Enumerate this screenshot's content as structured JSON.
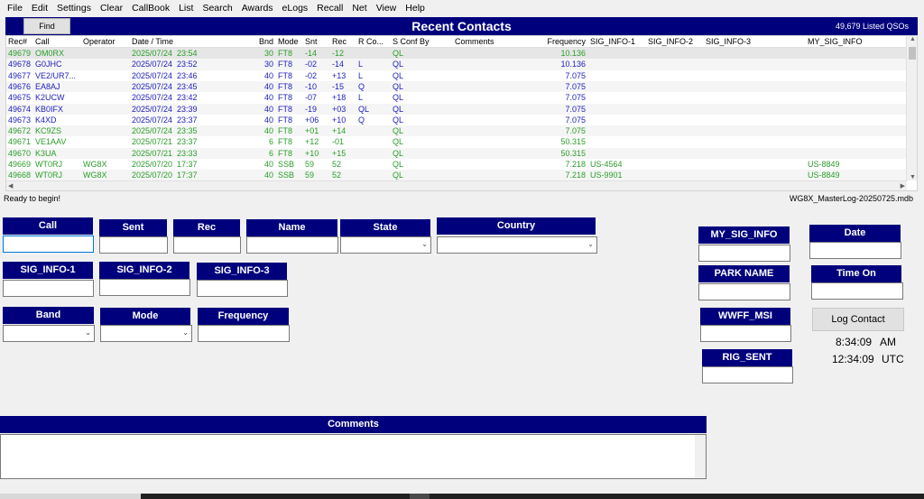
{
  "menu": [
    "File",
    "Edit",
    "Settings",
    "Clear",
    "CallBook",
    "List",
    "Search",
    "Awards",
    "eLogs",
    "Recall",
    "Net",
    "View",
    "Help"
  ],
  "recent": {
    "find_label": "Find",
    "title": "Recent Contacts",
    "count": "49,679 Listed QSOs"
  },
  "columns": [
    "Rec#",
    "Call",
    "Operator",
    "Date  /  Time",
    "Bnd",
    "Mode",
    "Snt",
    "Rec",
    "R Co...",
    "S Conf By",
    "Comments",
    "Frequency",
    "SIG_INFO-1",
    "SIG_INFO-2",
    "SIG_INFO-3",
    "MY_SIG_INFO"
  ],
  "rows": [
    {
      "rec": "49679",
      "call": "OM0RX",
      "op": "",
      "date": "2025/07/24",
      "time": "23:54",
      "bnd": "30",
      "mode": "FT8",
      "snt": "-14",
      "rcv": "-12",
      "rco": "",
      "sconf": "QL",
      "freq": "10.136",
      "sig1": "",
      "mysig": "",
      "color": "green"
    },
    {
      "rec": "49678",
      "call": "G0JHC",
      "op": "",
      "date": "2025/07/24",
      "time": "23:52",
      "bnd": "30",
      "mode": "FT8",
      "snt": "-02",
      "rcv": "-14",
      "rco": "L",
      "sconf": "QL",
      "freq": "10.136",
      "sig1": "",
      "mysig": "",
      "color": "blue"
    },
    {
      "rec": "49677",
      "call": "VE2/UR7...",
      "op": "",
      "date": "2025/07/24",
      "time": "23:46",
      "bnd": "40",
      "mode": "FT8",
      "snt": "-02",
      "rcv": "+13",
      "rco": "L",
      "sconf": "QL",
      "freq": "7.075",
      "sig1": "",
      "mysig": "",
      "color": "blue"
    },
    {
      "rec": "49676",
      "call": "EA8AJ",
      "op": "",
      "date": "2025/07/24",
      "time": "23:45",
      "bnd": "40",
      "mode": "FT8",
      "snt": "-10",
      "rcv": "-15",
      "rco": "Q",
      "sconf": "QL",
      "freq": "7.075",
      "sig1": "",
      "mysig": "",
      "color": "blue"
    },
    {
      "rec": "49675",
      "call": "K2UCW",
      "op": "",
      "date": "2025/07/24",
      "time": "23:42",
      "bnd": "40",
      "mode": "FT8",
      "snt": "-07",
      "rcv": "+18",
      "rco": "L",
      "sconf": "QL",
      "freq": "7.075",
      "sig1": "",
      "mysig": "",
      "color": "blue"
    },
    {
      "rec": "49674",
      "call": "KB0IFX",
      "op": "",
      "date": "2025/07/24",
      "time": "23:39",
      "bnd": "40",
      "mode": "FT8",
      "snt": "-19",
      "rcv": "+03",
      "rco": "QL",
      "sconf": "QL",
      "freq": "7.075",
      "sig1": "",
      "mysig": "",
      "color": "blue"
    },
    {
      "rec": "49673",
      "call": "K4XD",
      "op": "",
      "date": "2025/07/24",
      "time": "23:37",
      "bnd": "40",
      "mode": "FT8",
      "snt": "+06",
      "rcv": "+10",
      "rco": "Q",
      "sconf": "QL",
      "freq": "7.075",
      "sig1": "",
      "mysig": "",
      "color": "blue"
    },
    {
      "rec": "49672",
      "call": "KC9ZS",
      "op": "",
      "date": "2025/07/24",
      "time": "23:35",
      "bnd": "40",
      "mode": "FT8",
      "snt": "+01",
      "rcv": "+14",
      "rco": "",
      "sconf": "QL",
      "freq": "7.075",
      "sig1": "",
      "mysig": "",
      "color": "green"
    },
    {
      "rec": "49671",
      "call": "VE1AAV",
      "op": "",
      "date": "2025/07/21",
      "time": "23:37",
      "bnd": "6",
      "mode": "FT8",
      "snt": "+12",
      "rcv": "-01",
      "rco": "",
      "sconf": "QL",
      "freq": "50.315",
      "sig1": "",
      "mysig": "",
      "color": "green"
    },
    {
      "rec": "49670",
      "call": "K3UA",
      "op": "",
      "date": "2025/07/21",
      "time": "23:33",
      "bnd": "6",
      "mode": "FT8",
      "snt": "+10",
      "rcv": "+15",
      "rco": "",
      "sconf": "QL",
      "freq": "50.315",
      "sig1": "",
      "mysig": "",
      "color": "green"
    },
    {
      "rec": "49669",
      "call": "WT0RJ",
      "op": "WG8X",
      "date": "2025/07/20",
      "time": "17:37",
      "bnd": "40",
      "mode": "SSB",
      "snt": "59",
      "rcv": "52",
      "rco": "",
      "sconf": "QL",
      "freq": "7.218",
      "sig1": "US-4564",
      "mysig": "US-8849",
      "color": "green"
    },
    {
      "rec": "49668",
      "call": "WT0RJ",
      "op": "WG8X",
      "date": "2025/07/20",
      "time": "17:37",
      "bnd": "40",
      "mode": "SSB",
      "snt": "59",
      "rcv": "52",
      "rco": "",
      "sconf": "QL",
      "freq": "7.218",
      "sig1": "US-9901",
      "mysig": "US-8849",
      "color": "green"
    }
  ],
  "status": {
    "left": "Ready to begin!",
    "right": "WG8X_MasterLog-20250725.mdb"
  },
  "form": {
    "call": "Call",
    "sent": "Sent",
    "rec": "Rec",
    "name": "Name",
    "state": "State",
    "country": "Country",
    "sig1": "SIG_INFO-1",
    "sig2": "SIG_INFO-2",
    "sig3": "SIG_INFO-3",
    "band": "Band",
    "mode": "Mode",
    "frequency": "Frequency",
    "my_sig_info": "MY_SIG_INFO",
    "park_name": "PARK NAME",
    "wwff": "WWFF_MSI",
    "rig_sent": "RIG_SENT",
    "date": "Date",
    "time_on": "Time On",
    "log_contact": "Log Contact",
    "local_time": "8:34:09",
    "local_suffix": "AM",
    "utc_time": "12:34:09",
    "utc_suffix": "UTC",
    "comments": "Comments"
  },
  "colors": {
    "header_bg": "#00007d",
    "green_row": "#2a9d2a",
    "blue_row": "#2020c0"
  }
}
